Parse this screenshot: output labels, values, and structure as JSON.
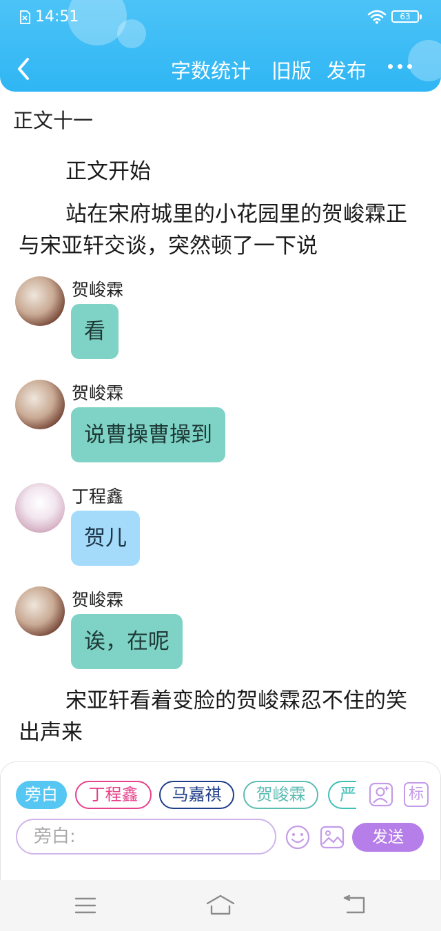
{
  "status_bar": {
    "time": "14:51",
    "battery": "63"
  },
  "nav": {
    "word_count": "字数统计",
    "old_version": "旧版",
    "publish": "发布"
  },
  "chapter": {
    "title": "正文十一",
    "opening": "正文开始",
    "paragraph1": "站在宋府城里的小花园里的贺峻霖正与宋亚轩交谈，突然顿了一下说",
    "paragraph2": "宋亚轩看着变脸的贺峻霖忍不住的笑出声来"
  },
  "messages": [
    {
      "sender": "贺峻霖",
      "text": "看"
    },
    {
      "sender": "贺峻霖",
      "text": "说曹操曹操到"
    },
    {
      "sender": "丁程鑫",
      "text": "贺儿"
    },
    {
      "sender": "贺峻霖",
      "text": "诶，在呢"
    }
  ],
  "role_chips": [
    "旁白",
    "丁程鑫",
    "马嘉祺",
    "贺峻霖",
    "严"
  ],
  "tag_button": "标",
  "input": {
    "value": "旁白:"
  },
  "send_label": "发送",
  "colors": {
    "header": "#2fb6f4",
    "bubble_green": "#7fd3c6",
    "bubble_blue": "#a4dafa",
    "send": "#b57ee8",
    "chip_dcx": "#e7418a",
    "chip_mjq": "#1f3e8a",
    "chip_hjl": "#5bbcb3"
  },
  "icons": [
    "sim-icon",
    "wifi-icon",
    "battery-icon",
    "back-chevron-icon",
    "more-icon",
    "add-character-icon",
    "emoji-icon",
    "image-icon",
    "menu-icon",
    "home-icon",
    "back-icon"
  ]
}
